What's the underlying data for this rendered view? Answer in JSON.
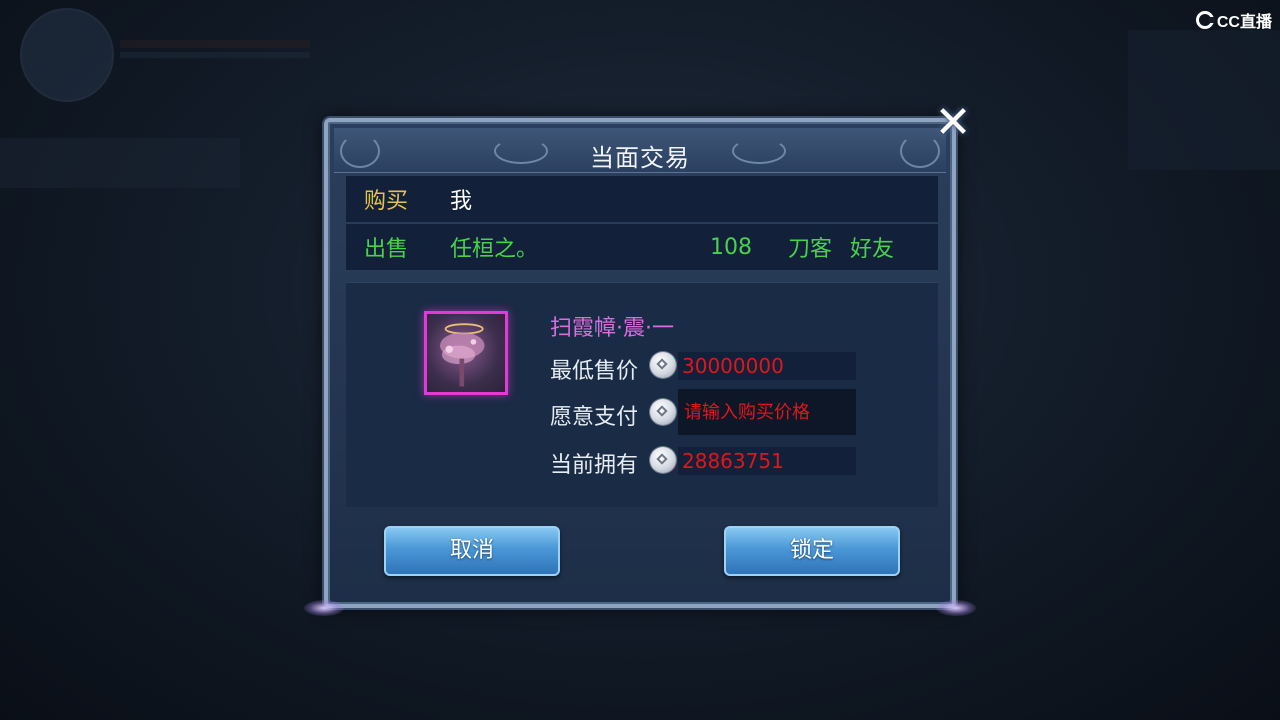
{
  "watermark": {
    "text": "CC直播"
  },
  "dialog": {
    "title": "当面交易",
    "close_icon": "close-x-icon"
  },
  "buy_row": {
    "label": "购买",
    "player": "我"
  },
  "sell_row": {
    "label": "出售",
    "player": "任桓之。",
    "level": "108",
    "class": "刀客",
    "relation": "好友"
  },
  "item": {
    "name": "扫霞幛·震·一",
    "icon": "item-icon",
    "rarity_color": "#e23ad6"
  },
  "fields": {
    "min_price_label": "最低售价",
    "min_price_value": "30000000",
    "offer_label": "愿意支付",
    "offer_placeholder": "请输入购买价格",
    "offer_value": "",
    "owned_label": "当前拥有",
    "owned_value": "28863751",
    "currency_icon": "silver-coin-icon"
  },
  "buttons": {
    "cancel": "取消",
    "lock": "锁定"
  }
}
